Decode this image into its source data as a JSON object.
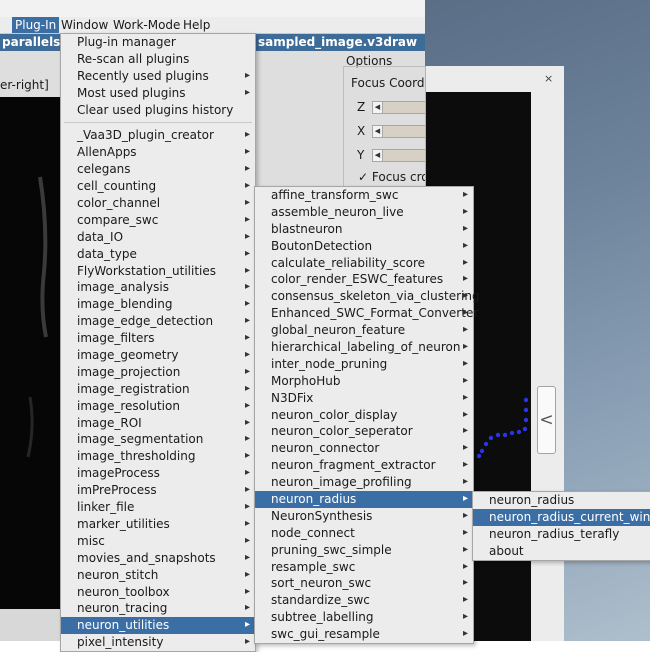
{
  "menubar": {
    "items": [
      {
        "label": "Plug-In",
        "active": true
      },
      {
        "label": "Window",
        "active": false
      },
      {
        "label": "Work-Mode",
        "active": false
      },
      {
        "label": "Help",
        "active": false
      }
    ]
  },
  "window": {
    "title_left": "parallels",
    "title_right": "sampled_image.v3draw",
    "view_label": "er-right]"
  },
  "options": {
    "title": "Options",
    "focus_label": "Focus Coordi",
    "axes": [
      "Z",
      "X",
      "Y"
    ],
    "focus_cross_label": "Focus cros",
    "focus_cross_checked": true
  },
  "dialog": {
    "close": "×",
    "collapse": "<"
  },
  "plugin_menu": {
    "top_items": [
      "Plug-in manager",
      "Re-scan all plugins",
      "Recently used plugins",
      "Most used plugins",
      "Clear used plugins history"
    ],
    "top_submenu_flags": [
      false,
      false,
      true,
      true,
      false
    ],
    "plugins": [
      "_Vaa3D_plugin_creator",
      "AllenApps",
      "celegans",
      "cell_counting",
      "color_channel",
      "compare_swc",
      "data_IO",
      "data_type",
      "FlyWorkstation_utilities",
      "image_analysis",
      "image_blending",
      "image_edge_detection",
      "image_filters",
      "image_geometry",
      "image_projection",
      "image_registration",
      "image_resolution",
      "image_ROI",
      "image_segmentation",
      "image_thresholding",
      "imageProcess",
      "imPreProcess",
      "linker_file",
      "marker_utilities",
      "misc",
      "movies_and_snapshots",
      "neuron_stitch",
      "neuron_toolbox",
      "neuron_tracing",
      "neuron_utilities",
      "pixel_intensity"
    ],
    "highlighted": "neuron_utilities"
  },
  "neuron_utilities_menu": {
    "items": [
      "affine_transform_swc",
      "assemble_neuron_live",
      "blastneuron",
      "BoutonDetection",
      "calculate_reliability_score",
      "color_render_ESWC_features",
      "consensus_skeleton_via_clustering",
      "Enhanced_SWC_Format_Converter",
      "global_neuron_feature",
      "hierarchical_labeling_of_neuron",
      "inter_node_pruning",
      "MorphoHub",
      "N3DFix",
      "neuron_color_display",
      "neuron_color_seperator",
      "neuron_connector",
      "neuron_fragment_extractor",
      "neuron_image_profiling",
      "neuron_radius",
      "NeuronSynthesis",
      "node_connect",
      "pruning_swc_simple",
      "resample_swc",
      "sort_neuron_swc",
      "standardize_swc",
      "subtree_labelling",
      "swc_gui_resample"
    ],
    "highlighted": "neuron_radius"
  },
  "neuron_radius_menu": {
    "items": [
      "neuron_radius",
      "neuron_radius_current_window",
      "neuron_radius_terafly",
      "about"
    ],
    "highlighted": "neuron_radius_current_window"
  },
  "icons": {
    "submenu": "chevron-right-icon",
    "close": "close-icon",
    "collapse": "chevron-left-icon",
    "slider_arrow": "triangle-left-icon",
    "checkbox": "check-icon"
  },
  "colors": {
    "highlight": "#3b6ea5",
    "title_bar": "#3d6c99",
    "menu_bg": "#ececec",
    "trace_dots": "#2a35e8"
  }
}
